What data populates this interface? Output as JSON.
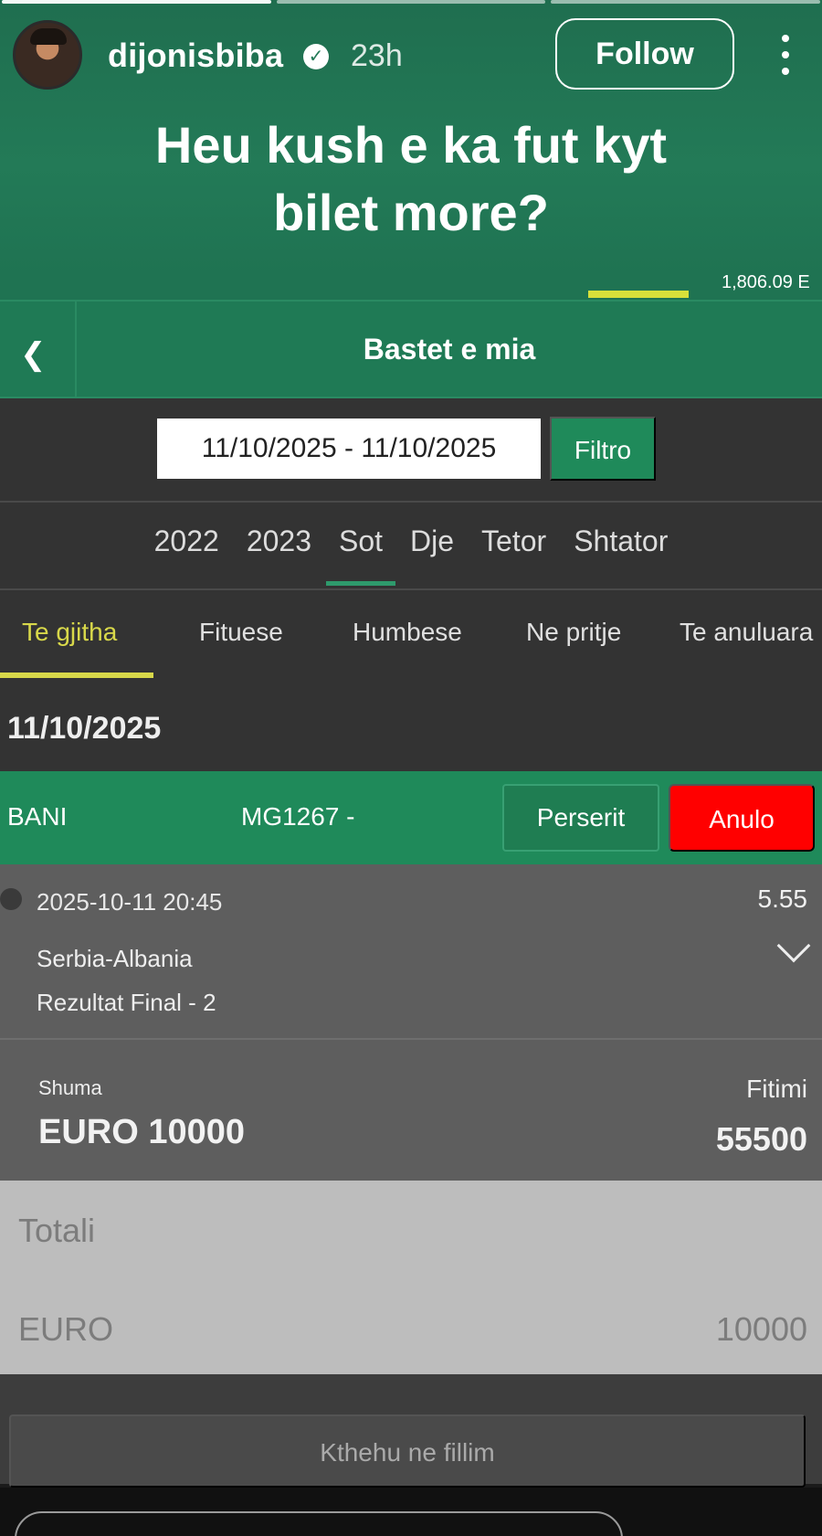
{
  "story": {
    "username": "dijonisbiba",
    "time_ago": "23h",
    "follow_label": "Follow",
    "caption_line1": "Heu kush e ka fut kyt",
    "caption_line2": "bilet more?",
    "balance_partial": "1,806.09 E"
  },
  "app": {
    "title": "Bastet e mia",
    "date_range": "11/10/2025 - 11/10/2025",
    "filter_label": "Filtro",
    "period_tabs": [
      "2022",
      "2023",
      "Sot",
      "Dje",
      "Tetor",
      "Shtator"
    ],
    "active_period": "Sot",
    "status_tabs": [
      "Te gjitha",
      "Fituese",
      "Humbese",
      "Ne pritje",
      "Te anuluara"
    ],
    "active_status": "Te gjitha",
    "section_date": "11/10/2025"
  },
  "bet": {
    "user": "BANI",
    "code": "MG1267 -",
    "repeat_label": "Perserit",
    "cancel_label": "Anulo",
    "datetime": "2025-10-11 20:45",
    "odds": "5.55",
    "match": "Serbia-Albania",
    "market": "Rezultat Final - 2",
    "stake_label": "Shuma",
    "stake_value": "EURO 10000",
    "win_label": "Fitimi",
    "win_value": "55500"
  },
  "totals": {
    "title": "Totali",
    "currency": "EURO",
    "amount": "10000"
  },
  "footer": {
    "home_label": "Kthehu ne fillim"
  },
  "colors": {
    "brand_green": "#1f7a55",
    "accent_yellow": "#d8d84a",
    "cancel_red": "#ff0000"
  }
}
